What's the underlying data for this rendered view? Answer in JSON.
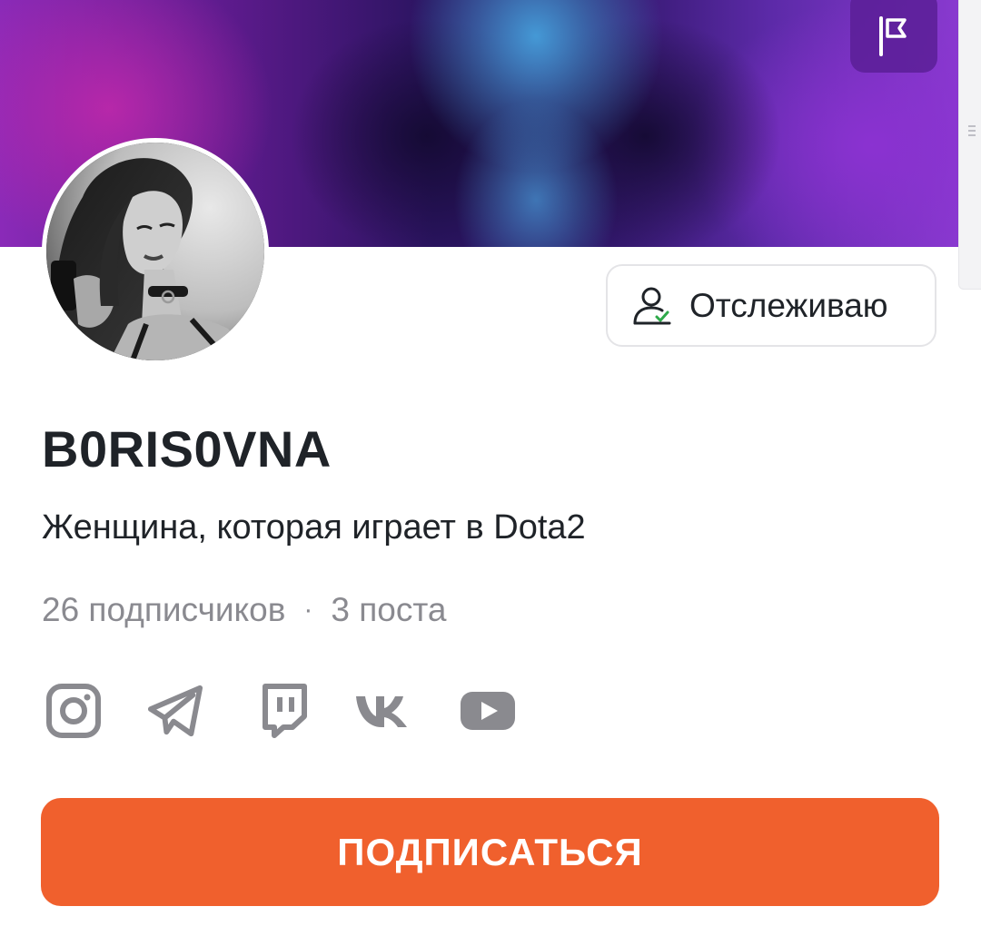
{
  "profile": {
    "username": "B0RIS0VNA",
    "bio": "Женщина, которая играет в Dota2",
    "followers": "26 подписчиков",
    "separator": "·",
    "posts": "3 поста"
  },
  "actions": {
    "follow_status_label": "Отслеживаю",
    "subscribe_label": "ПОДПИСАТЬСЯ",
    "report_icon": "flag-icon"
  },
  "socials": [
    {
      "name": "instagram",
      "icon": "instagram-icon"
    },
    {
      "name": "telegram",
      "icon": "telegram-icon"
    },
    {
      "name": "twitch",
      "icon": "twitch-icon"
    },
    {
      "name": "vk",
      "icon": "vk-icon"
    },
    {
      "name": "youtube",
      "icon": "youtube-icon"
    }
  ],
  "colors": {
    "accent": "#f0602d",
    "icon_gray": "#8a8a8f",
    "text": "#1f2328",
    "muted": "#8a8a90",
    "check_green": "#2eaa4a"
  }
}
